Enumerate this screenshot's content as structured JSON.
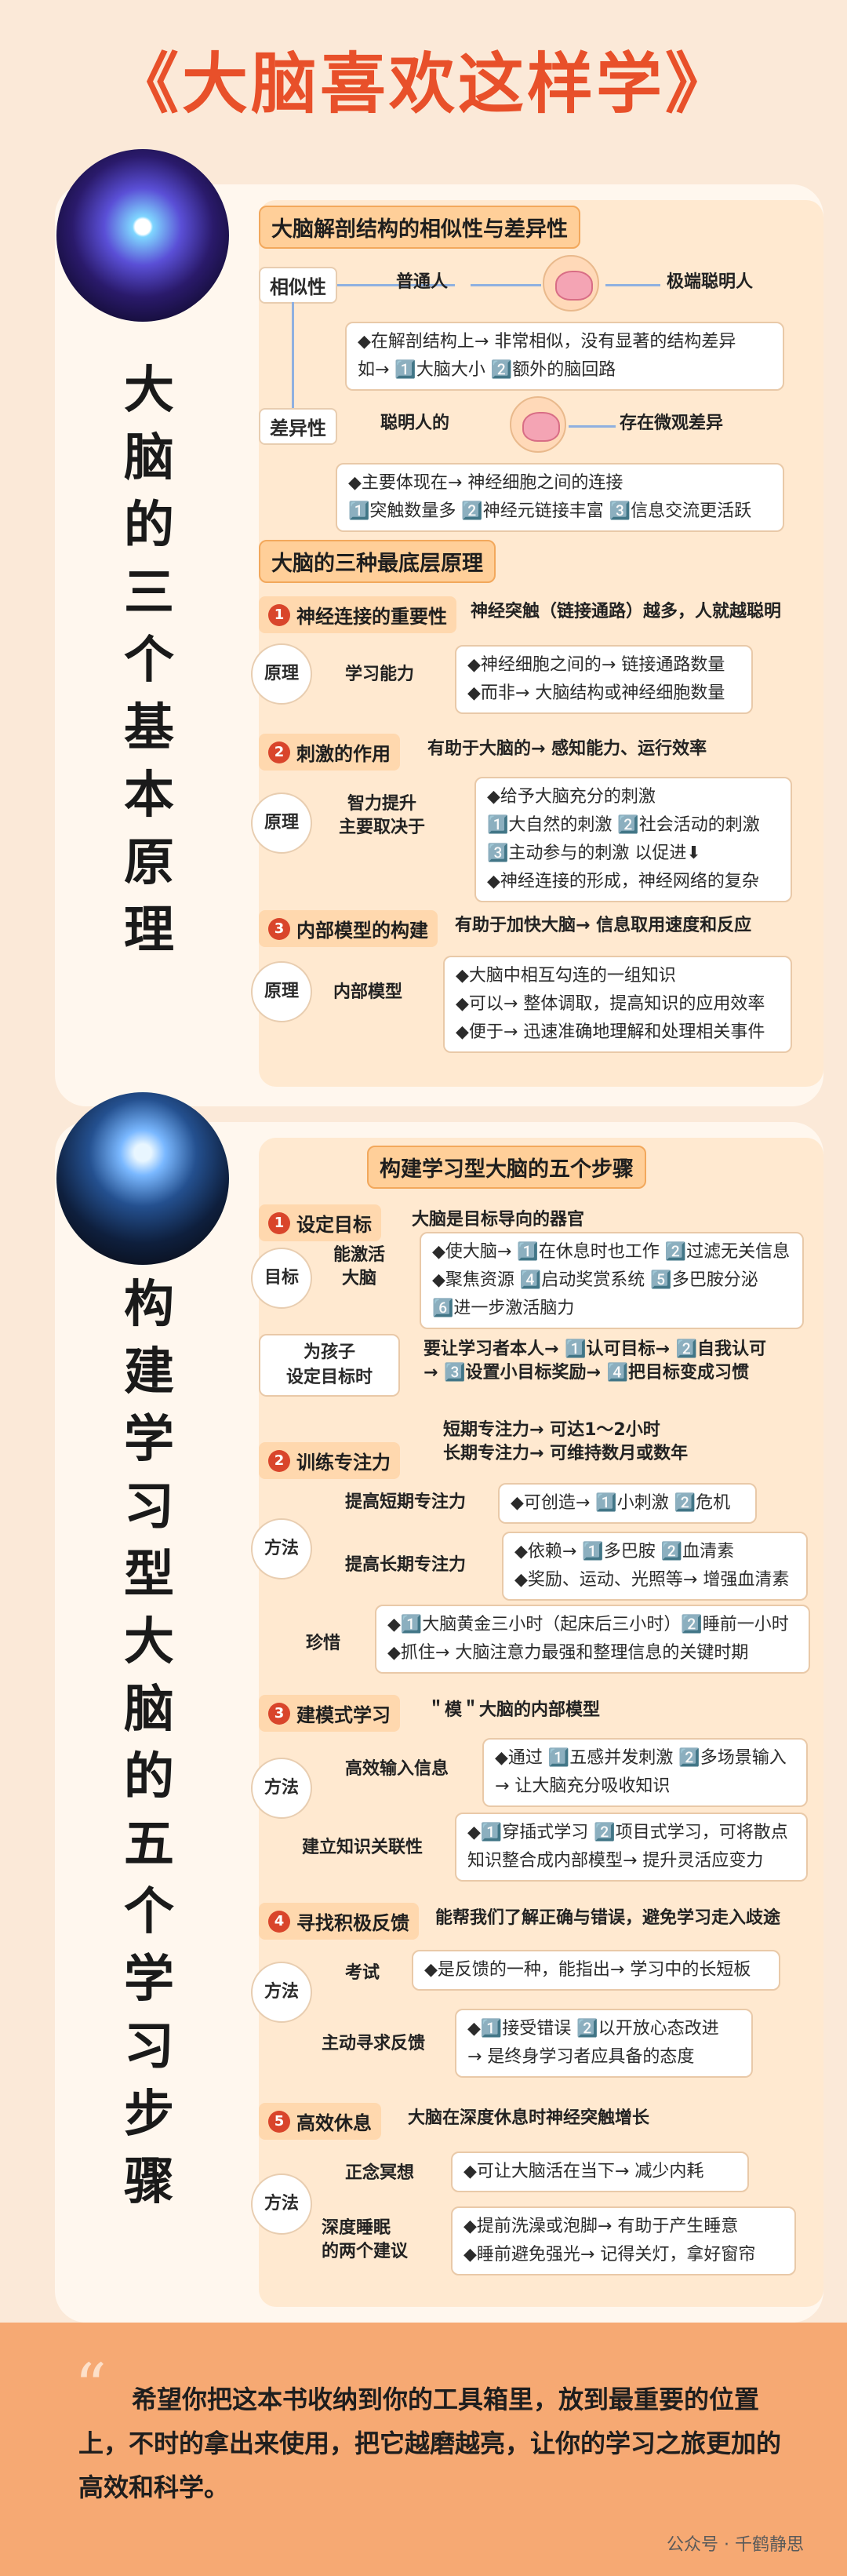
{
  "title": "《大脑喜欢这样学》",
  "section1": {
    "vertical_title": [
      "大",
      "脑",
      "的",
      "三",
      "个",
      "基",
      "本",
      "原",
      "理"
    ],
    "header1": "大脑解剖结构的相似性与差异性",
    "similar_label": "相似性",
    "normal_person": "普通人",
    "smart_person": "极端聪明人",
    "similar_box": [
      "◆在解剖结构上→ 非常相似，没有显著的结构差异",
      "如→ 1️⃣大脑大小 2️⃣额外的脑回路"
    ],
    "diff_label": "差异性",
    "smart_person2": "聪明人的",
    "micro_diff": "存在微观差异",
    "diff_box": [
      "◆主要体现在→ 神经细胞之间的连接",
      "1️⃣突触数量多 2️⃣神经元链接丰富 3️⃣信息交流更活跃"
    ],
    "header2": "大脑的三种最底层原理",
    "p1_title": "神经连接的重要性",
    "p1_desc": "神经突触（链接通路）越多，人就越聪明",
    "p1_circle": "原理",
    "p1_label": "学习能力",
    "p1_box": [
      "◆神经细胞之间的→ 链接通路数量",
      "◆而非→ 大脑结构或神经细胞数量"
    ],
    "p2_title": "刺激的作用",
    "p2_desc": "有助于大脑的→ 感知能力、运行效率",
    "p2_circle": "原理",
    "p2_label": "智力提升\n主要取决于",
    "p2_box": [
      "◆给予大脑充分的刺激",
      "1️⃣大自然的刺激 2️⃣社会活动的刺激",
      "3️⃣主动参与的刺激  以促进⬇",
      "◆神经连接的形成，神经网络的复杂"
    ],
    "p3_title": "内部模型的构建",
    "p3_desc": "有助于加快大脑→ 信息取用速度和反应",
    "p3_circle": "原理",
    "p3_label": "内部模型",
    "p3_box": [
      "◆大脑中相互勾连的一组知识",
      "◆可以→ 整体调取，提高知识的应用效率",
      "◆便于→ 迅速准确地理解和处理相关事件"
    ]
  },
  "section2": {
    "vertical_title": [
      "构",
      "建",
      "学",
      "习",
      "型",
      "大",
      "脑",
      "的",
      "五",
      "个",
      "学",
      "习",
      "步",
      "骤"
    ],
    "header": "构建学习型大脑的五个步骤",
    "s1_title": "设定目标",
    "s1_desc": "大脑是目标导向的器官",
    "s1_circle": "目标",
    "s1_label": "能激活\n大脑",
    "s1_box": [
      "◆使大脑→ 1️⃣在休息时也工作 2️⃣过滤无关信息",
      "◆聚焦资源 4️⃣启动奖赏系统 5️⃣多巴胺分泌",
      "6️⃣进一步激活脑力"
    ],
    "kid_label": "为孩子\n设定目标时",
    "kid_text": [
      "要让学习者本人→ 1️⃣认可目标→ 2️⃣自我认可",
      "→ 3️⃣设置小目标奖励→ 4️⃣把目标变成习惯"
    ],
    "s2_title": "训练专注力",
    "s2_desc": [
      "短期专注力→ 可达1～2小时",
      "长期专注力→ 可维持数月或数年"
    ],
    "s2_circle": "方法",
    "s2_a_label": "提高短期专注力",
    "s2_a_box": "◆可创造→ 1️⃣小刺激 2️⃣危机",
    "s2_b_label": "提高长期专注力",
    "s2_b_box": [
      "◆依赖→ 1️⃣多巴胺 2️⃣血清素",
      "◆奖励、运动、光照等→ 增强血清素"
    ],
    "s2_c_label": "珍惜",
    "s2_c_box": [
      "◆1️⃣大脑黄金三小时（起床后三小时）2️⃣睡前一小时",
      "◆抓住→ 大脑注意力最强和整理信息的关键时期"
    ],
    "s3_title": "建模式学习",
    "s3_desc": "＂模＂大脑的内部模型",
    "s3_circle": "方法",
    "s3_a_label": "高效输入信息",
    "s3_a_box": [
      "◆通过 1️⃣五感并发刺激 2️⃣多场景输入",
      "→ 让大脑充分吸收知识"
    ],
    "s3_b_label": "建立知识关联性",
    "s3_b_box": [
      "◆1️⃣穿插式学习 2️⃣项目式学习，可将散点",
      "知识整合成内部模型→ 提升灵活应变力"
    ],
    "s4_title": "寻找积极反馈",
    "s4_desc": "能帮我们了解正确与错误，避免学习走入歧途",
    "s4_circle": "方法",
    "s4_a_label": "考试",
    "s4_a_box": "◆是反馈的一种，能指出→ 学习中的长短板",
    "s4_b_label": "主动寻求反馈",
    "s4_b_box": [
      "◆1️⃣接受错误 2️⃣以开放心态改进",
      "→ 是终身学习者应具备的态度"
    ],
    "s5_title": "高效休息",
    "s5_desc": "大脑在深度休息时神经突触增长",
    "s5_circle": "方法",
    "s5_a_label": "正念冥想",
    "s5_a_box": "◆可让大脑活在当下→ 减少内耗",
    "s5_b_label": "深度睡眠\n的两个建议",
    "s5_b_box": [
      "◆提前洗澡或泡脚→ 有助于产生睡意",
      "◆睡前避免强光→ 记得关灯，拿好窗帘"
    ]
  },
  "closing": "希望你把这本书收纳到你的工具箱里，放到最重要的位置上，不时的拿出来使用，把它越磨越亮，让你的学习之旅更加的高效和科学。",
  "signature": "公众号 · 千鹤静思",
  "colors": {
    "title": "#e8502a",
    "panel": "#fff7ee",
    "inner": "#ffe9d0",
    "header": "#ffcf99",
    "bottom": "#f6a973"
  }
}
